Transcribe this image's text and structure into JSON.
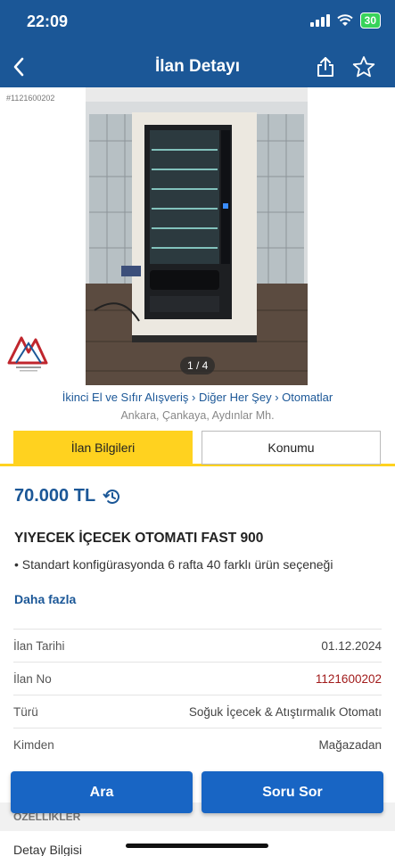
{
  "status_bar": {
    "time": "22:09",
    "battery": "30"
  },
  "nav": {
    "title": "İlan Detayı"
  },
  "gallery": {
    "ad_no_overlay": "#1121600202",
    "pager": "1 / 4"
  },
  "breadcrumb": "İkinci El ve Sıfır Alışveriş › Diğer Her Şey › Otomatlar",
  "location": "Ankara, Çankaya, Aydınlar Mh.",
  "tabs": [
    {
      "label": "İlan Bilgileri",
      "active": true
    },
    {
      "label": "Konumu",
      "active": false
    }
  ],
  "listing": {
    "price": "70.000 TL",
    "title": "YIYECEK İÇECEK OTOMATI FAST 900",
    "bullet": "• Standart konfigürasyonda 6 rafta 40 farklı ürün seçeneği",
    "more_label": "Daha fazla"
  },
  "info": [
    {
      "key": "İlan Tarihi",
      "value": "01.12.2024"
    },
    {
      "key": "İlan No",
      "value": "1121600202"
    },
    {
      "key": "Türü",
      "value": "Soğuk İçecek & Atıştırmalık Otomatı"
    },
    {
      "key": "Kimden",
      "value": "Mağazadan"
    }
  ],
  "features_header": "ÖZELLİKLER",
  "detail_info": "Detay Bilgisi",
  "actions": {
    "call": "Ara",
    "ask": "Soru Sor"
  },
  "colors": {
    "header": "#1b5797",
    "tab_active": "#ffd21f",
    "button": "#1865c4",
    "ad_no": "#a11b1b"
  }
}
